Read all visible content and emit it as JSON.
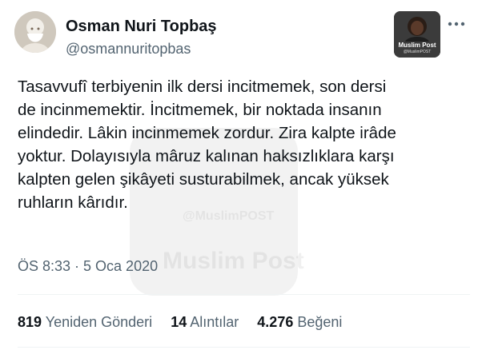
{
  "author": {
    "display_name": "Osman Nuri Topbaş",
    "handle": "@osmannuritopbas"
  },
  "badge": {
    "title": "Muslim Post",
    "subtitle": "@MuslimPOST"
  },
  "watermark": {
    "text": "Muslim Post",
    "small_text": "@MuslimPOST"
  },
  "tweet": {
    "lines": [
      "Tasavvufî terbiyenin ilk dersi incitmemek, son dersi",
      "de incinmemektir. İncitmemek, bir noktada insanın",
      "elindedir. Lâkin incinmemek zordur. Zira kalpte irâde",
      "yoktur. Dolayısıyla mâruz kalınan haksızlıklara karşı",
      "kalpten gelen şikâyeti susturabilmek, ancak yüksek",
      "ruhların kârıdır."
    ],
    "timestamp": "ÖS 8:33 · 5 Oca 2020"
  },
  "stats": {
    "retweets_count": "819",
    "retweets_label": "Yeniden Gönderi",
    "quotes_count": "14",
    "quotes_label": "Alıntılar",
    "likes_count": "4.276",
    "likes_label": "Beğeni"
  },
  "colors": {
    "text": "#0f1419",
    "secondary": "#536471",
    "divider": "#eff3f4"
  },
  "icons": [
    "more-options-icon"
  ]
}
